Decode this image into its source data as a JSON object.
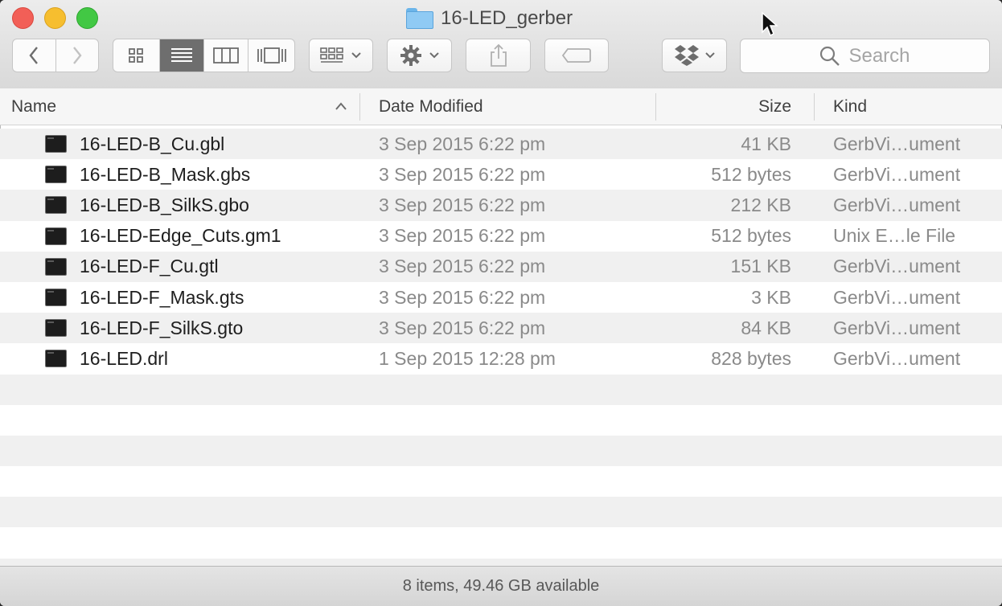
{
  "window": {
    "title": "16-LED_gerber"
  },
  "toolbar": {
    "search_placeholder": "Search",
    "view_modes": [
      "icon",
      "list",
      "column",
      "cover-flow"
    ],
    "active_view": "list"
  },
  "columns": {
    "name": "Name",
    "date": "Date Modified",
    "size": "Size",
    "kind": "Kind",
    "sort_indicator": "^"
  },
  "files": [
    {
      "name": "16-LED-B_Cu.gbl",
      "date": "3 Sep 2015 6:22 pm",
      "size": "41 KB",
      "kind": "GerbVi…ument"
    },
    {
      "name": "16-LED-B_Mask.gbs",
      "date": "3 Sep 2015 6:22 pm",
      "size": "512 bytes",
      "kind": "GerbVi…ument"
    },
    {
      "name": "16-LED-B_SilkS.gbo",
      "date": "3 Sep 2015 6:22 pm",
      "size": "212 KB",
      "kind": "GerbVi…ument"
    },
    {
      "name": "16-LED-Edge_Cuts.gm1",
      "date": "3 Sep 2015 6:22 pm",
      "size": "512 bytes",
      "kind": "Unix E…le File"
    },
    {
      "name": "16-LED-F_Cu.gtl",
      "date": "3 Sep 2015 6:22 pm",
      "size": "151 KB",
      "kind": "GerbVi…ument"
    },
    {
      "name": "16-LED-F_Mask.gts",
      "date": "3 Sep 2015 6:22 pm",
      "size": "3 KB",
      "kind": "GerbVi…ument"
    },
    {
      "name": "16-LED-F_SilkS.gto",
      "date": "3 Sep 2015 6:22 pm",
      "size": "84 KB",
      "kind": "GerbVi…ument"
    },
    {
      "name": "16-LED.drl",
      "date": "1 Sep 2015 12:28 pm",
      "size": "828 bytes",
      "kind": "GerbVi…ument"
    }
  ],
  "status": {
    "text": "8 items, 49.46 GB available"
  }
}
